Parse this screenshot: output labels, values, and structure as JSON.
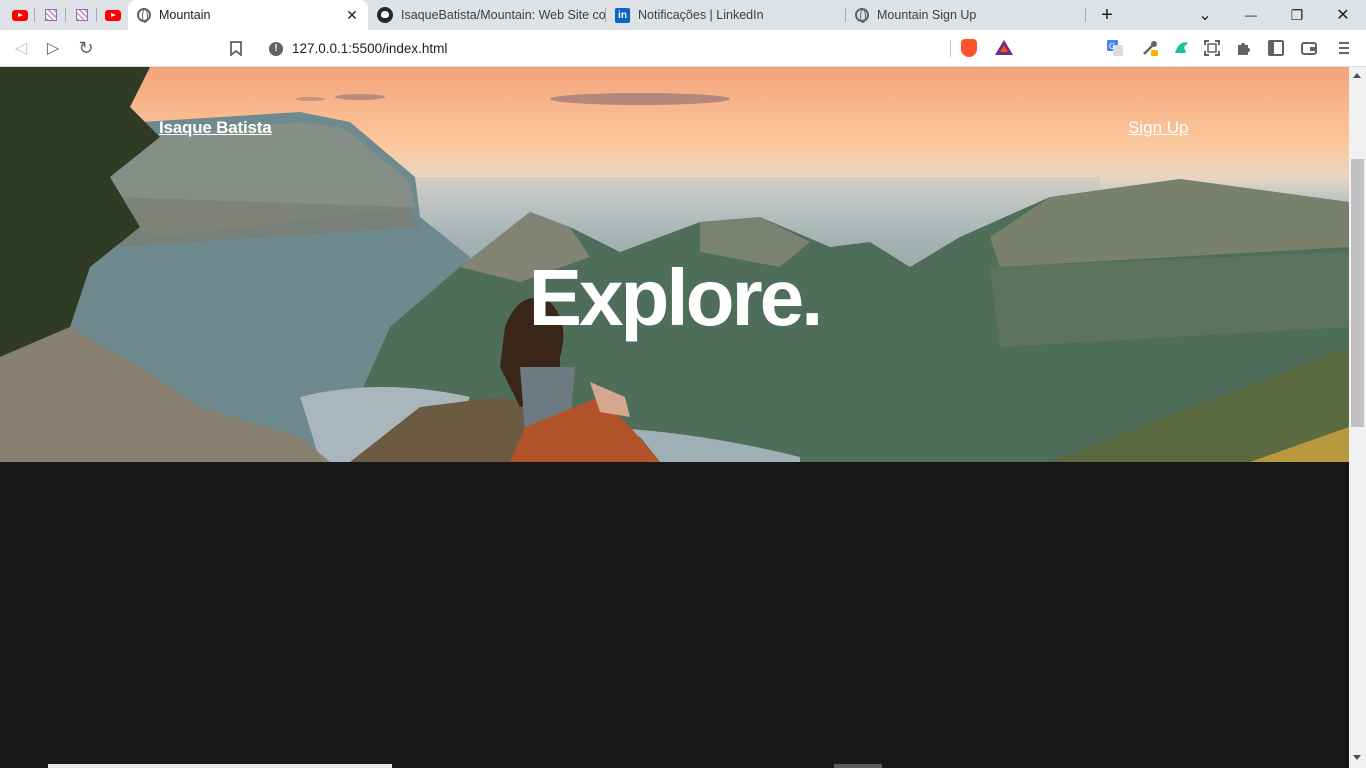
{
  "browser": {
    "pinned_tabs": [
      "youtube-icon",
      "tile-icon",
      "tile-icon",
      "youtube-icon"
    ],
    "tabs": [
      {
        "title": "Mountain",
        "icon": "globe-icon",
        "active": true,
        "close": "✕"
      },
      {
        "title": "IsaqueBatista/Mountain: Web Site com",
        "icon": "github-icon",
        "active": false
      },
      {
        "title": "Notificações | LinkedIn",
        "icon": "linkedin-icon",
        "active": false
      },
      {
        "title": "Mountain Sign Up",
        "icon": "globe-icon",
        "active": false
      }
    ],
    "linkedin_letters": "in",
    "new_tab": "+",
    "window_buttons": {
      "tab_search": "⌄",
      "minimize": "—",
      "restore": "❐",
      "close": "✕"
    },
    "toolbar": {
      "back": "◁",
      "forward": "▷",
      "reload": "↻",
      "url": "127.0.0.1:5500/index.html",
      "info": "!"
    },
    "colors": {
      "youtube": "#ff0000",
      "brave": "#fb542b",
      "linkedin": "#0a66c2"
    }
  },
  "page": {
    "brand": "Isaque Batista",
    "signup": "Sign Up",
    "headline": "Explore."
  }
}
